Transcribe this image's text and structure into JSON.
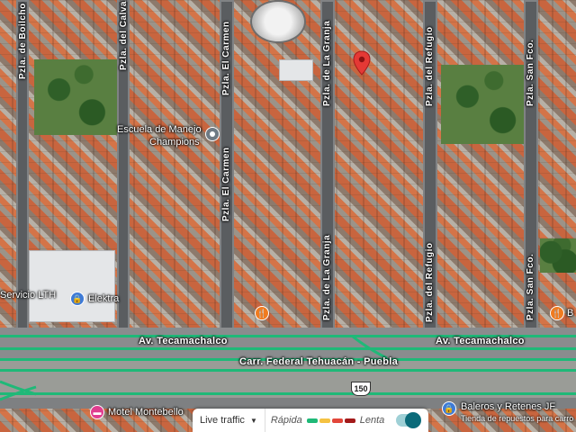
{
  "streets": [
    {
      "label": "Pzla. de Boilcho"
    },
    {
      "label": "Pzla. del Calvario"
    },
    {
      "label": "Pzla. El Carmen"
    },
    {
      "label": "Pzla. El Carmen"
    },
    {
      "label": "Pzla. de La Granja"
    },
    {
      "label": "Pzla. de La Granja"
    },
    {
      "label": "Pzla. del Refugio"
    },
    {
      "label": "Pzla. del Refugio"
    },
    {
      "label": "Pzla. San Fco."
    },
    {
      "label": "Pzla. San Fco."
    }
  ],
  "avenues": {
    "tecamachalco_left": "Av. Tecamachalco",
    "tecamachalco_right": "Av. Tecamachalco",
    "federal": "Carr. Federal Tehuacán - Puebla",
    "route_shield": "150"
  },
  "pois": {
    "driving_school": {
      "line1": "Escuela de Manejo",
      "line2": "Champions",
      "icon": "pin-dot-icon"
    },
    "servicio": {
      "label": "Servicio LTH"
    },
    "elektra": {
      "label": "Elektra",
      "icon": "shopping-bag-icon"
    },
    "motel": {
      "label": "Motel Montebello",
      "icon": "bed-icon"
    },
    "baleros": {
      "label": "Baleros y Retenes JF",
      "sub": "Tienda de repuestos para carro",
      "icon": "shopping-bag-icon"
    },
    "restaurant_icon": "fork-knife-icon",
    "restaurant_right_label": "B"
  },
  "traffic": {
    "label": "Live traffic",
    "fast": "Rápida",
    "slow": "Lenta",
    "colors": [
      "#1fb978",
      "#f5c242",
      "#e2463a",
      "#a31a1a"
    ],
    "toggle_on": true
  },
  "accent": {
    "pin": "#e53935",
    "traffic_line": "#1fb978"
  }
}
